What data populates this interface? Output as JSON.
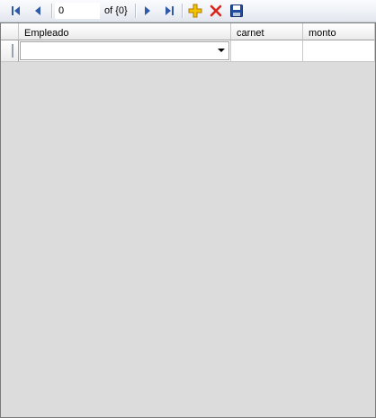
{
  "navigator": {
    "position_value": "0",
    "count_label": "of {0}",
    "icons": {
      "first": "move-first-icon",
      "previous": "move-previous-icon",
      "next": "move-next-icon",
      "last": "move-last-icon",
      "add": "add-new-icon",
      "delete": "delete-icon",
      "save": "save-icon"
    },
    "colors": {
      "nav_arrow": "#2f5aa8",
      "add": "#e8a800",
      "delete": "#d9261c",
      "save": "#1f4c9c"
    }
  },
  "grid": {
    "columns": [
      {
        "label": "Empleado",
        "editor": "combobox"
      },
      {
        "label": "carnet",
        "editor": "text"
      },
      {
        "label": "monto",
        "editor": "text"
      }
    ],
    "new_row": {
      "empleado": "",
      "carnet": "",
      "monto": ""
    },
    "background_color": "#dcdcdc"
  }
}
